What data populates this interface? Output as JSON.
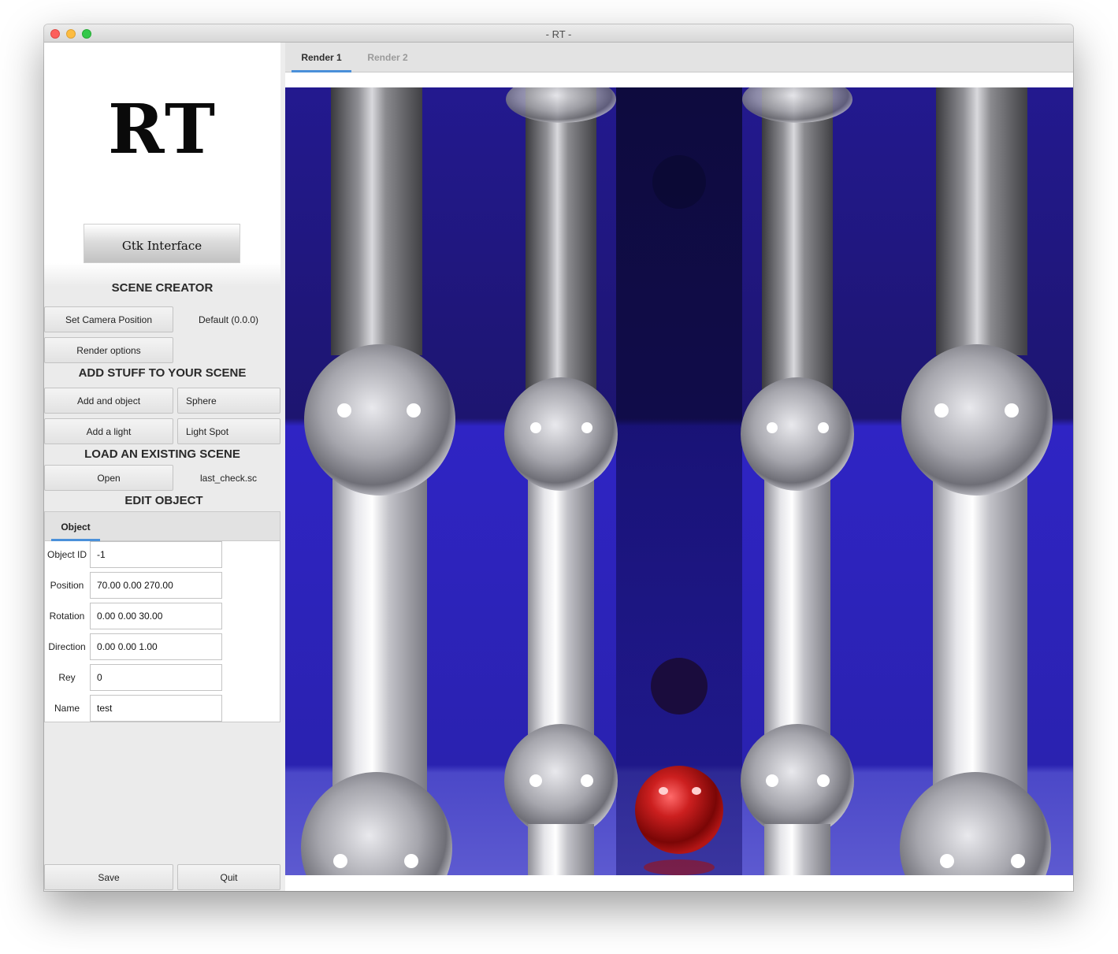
{
  "window": {
    "title": "- RT -"
  },
  "logo": {
    "text": "RT",
    "subtitle_button": "Gtk Interface"
  },
  "scene_creator": {
    "title": "SCENE CREATOR",
    "set_camera_button": "Set Camera Position",
    "camera_value": "Default (0.0.0)",
    "render_options_button": "Render options"
  },
  "add_stuff": {
    "title": "ADD STUFF TO YOUR SCENE",
    "add_object_button": "Add and object",
    "object_type": "Sphere",
    "add_light_button": "Add a light",
    "light_type": "Light Spot"
  },
  "load_scene": {
    "title": "LOAD AN EXISTING SCENE",
    "open_button": "Open",
    "file_name": "last_check.sc"
  },
  "edit_object": {
    "title": "EDIT OBJECT",
    "tab": "Object",
    "fields": [
      {
        "label": "Object ID",
        "value": "-1"
      },
      {
        "label": "Position",
        "value": "70.00 0.00 270.00"
      },
      {
        "label": "Rotation",
        "value": "0.00 0.00 30.00"
      },
      {
        "label": "Direction",
        "value": "0.00 0.00 1.00"
      },
      {
        "label": "Rey",
        "value": "0"
      },
      {
        "label": "Name",
        "value": "test"
      }
    ]
  },
  "footer": {
    "save_button": "Save",
    "quit_button": "Quit"
  },
  "render_tabs": [
    {
      "label": "Render 1",
      "active": true
    },
    {
      "label": "Render 2",
      "active": false
    }
  ],
  "colors": {
    "accent": "#4a90d9",
    "render_background": "#2a1fa8",
    "red_sphere": "#c41a1a"
  }
}
